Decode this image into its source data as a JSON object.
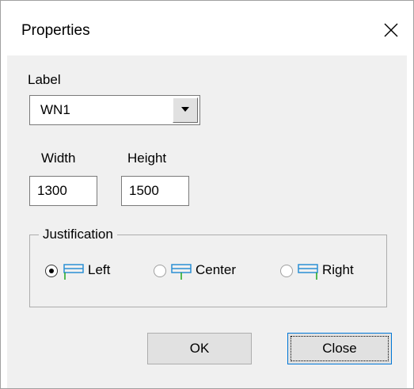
{
  "window": {
    "title": "Properties"
  },
  "label_section": {
    "label": "Label",
    "selected": "WN1"
  },
  "size": {
    "width_label": "Width",
    "width_value": "1300",
    "height_label": "Height",
    "height_value": "1500"
  },
  "justification": {
    "title": "Justification",
    "selected": "Left",
    "options": [
      {
        "label": "Left",
        "checked": true
      },
      {
        "label": "Center",
        "checked": false
      },
      {
        "label": "Right",
        "checked": false
      }
    ]
  },
  "buttons": {
    "ok": "OK",
    "close": "Close"
  },
  "colors": {
    "icon_blue": "#2b8fd4",
    "icon_green": "#1fa81f"
  }
}
